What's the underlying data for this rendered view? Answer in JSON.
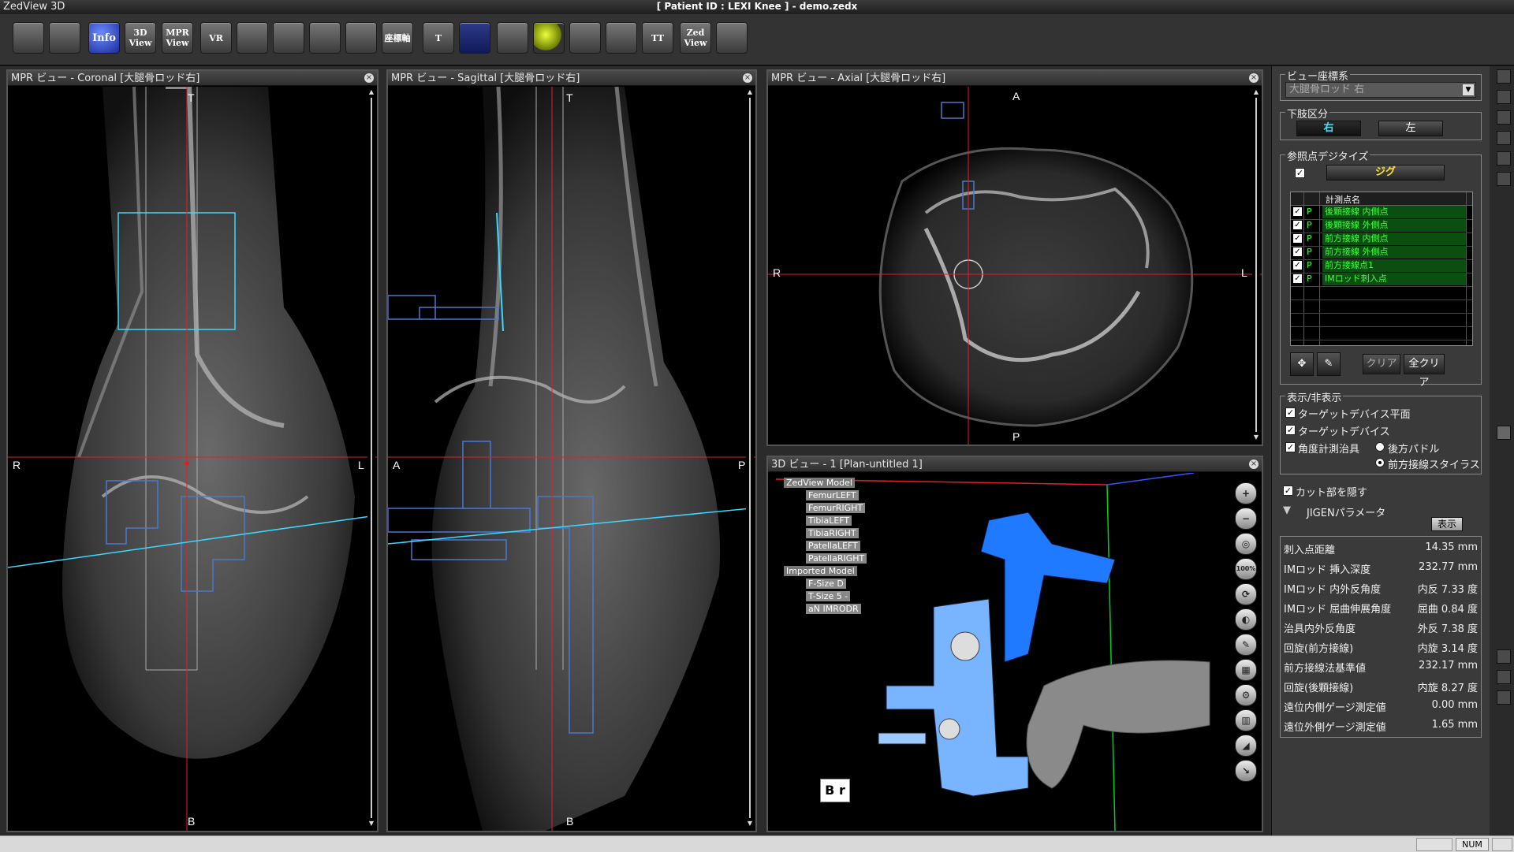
{
  "window": {
    "app_title": "ZedView 3D",
    "doc_title": "[ Patient ID : LEXI Knee ]  - demo.zedx"
  },
  "toolbar": {
    "buttons": [
      {
        "name": "tb-disk1-button",
        "label": ""
      },
      {
        "name": "tb-disk2-button",
        "label": ""
      },
      {
        "name": "tb-info-button",
        "label": "Info"
      },
      {
        "name": "tb-3dview-button",
        "label": "3D View"
      },
      {
        "name": "tb-mprview-button",
        "label": "MPR View"
      },
      {
        "name": "tb-vr-button",
        "label": "VR"
      },
      {
        "name": "tb-layout-button",
        "label": ""
      },
      {
        "name": "tb-slab-button",
        "label": ""
      },
      {
        "name": "tb-capture-button",
        "label": ""
      },
      {
        "name": "tb-zoom-button",
        "label": ""
      },
      {
        "name": "tb-coordaxis-button",
        "label": "座標軸"
      },
      {
        "name": "tb-text-button",
        "label": "T"
      },
      {
        "name": "tb-grid-button",
        "label": ""
      },
      {
        "name": "tb-cube-button",
        "label": ""
      },
      {
        "name": "tb-ball-button",
        "label": ""
      },
      {
        "name": "tb-eye-button",
        "label": ""
      },
      {
        "name": "tb-box-button",
        "label": ""
      },
      {
        "name": "tb-tt-button",
        "label": "TT"
      },
      {
        "name": "tb-zedview-button",
        "label": "Zed View"
      },
      {
        "name": "tb-dial-button",
        "label": ""
      }
    ]
  },
  "views": {
    "coronal": {
      "title": "MPR ビュー - Coronal [大腿骨ロッド右]",
      "top": "T",
      "bottom": "B",
      "left": "R",
      "right": "L"
    },
    "sagittal": {
      "title": "MPR ビュー - Sagittal [大腿骨ロッド右]",
      "top": "T",
      "bottom": "B",
      "left": "A",
      "right": "P"
    },
    "axial": {
      "title": "MPR ビュー - Axial [大腿骨ロッド右]",
      "top": "A",
      "bottom": "P",
      "left": "R",
      "right": "L"
    },
    "view3d": {
      "title": "3D ビュー - 1 [Plan-untitled 1]",
      "tree": {
        "group1": "ZedView Model",
        "items1": [
          "FemurLEFT",
          "FemurRIGHT",
          "TibiaLEFT",
          "TibiaRIGHT",
          "PatellaLEFT",
          "PatellaRIGHT"
        ],
        "group2": "Imported Model",
        "items2": [
          "F-Size D",
          "T-Size 5 -",
          "aN IMRODR"
        ]
      },
      "tools": [
        "+",
        "−",
        "◎",
        "100%",
        "⟳",
        "◐",
        "✎",
        "▦",
        "⚙",
        "▥",
        "◢",
        "↘"
      ],
      "cube_label": "B r"
    }
  },
  "panel": {
    "view_coord": {
      "label": "ビュー座標系",
      "value": "大腿骨ロッド 右"
    },
    "limb": {
      "label": "下肢区分",
      "right": "右",
      "left": "左"
    },
    "digitize": {
      "label": "参照点デジタイズ",
      "jig": "ジグ",
      "checked": "✓"
    },
    "table": {
      "header": "計測点名",
      "rows": [
        {
          "p": "P",
          "name": "後顆接線 内側点"
        },
        {
          "p": "P",
          "name": "後顆接線 外側点"
        },
        {
          "p": "P",
          "name": "前方接線 内側点"
        },
        {
          "p": "P",
          "name": "前方接線 外側点"
        },
        {
          "p": "P",
          "name": "前方接線点1"
        },
        {
          "p": "P",
          "name": "IMロッド刺入点"
        }
      ]
    },
    "buttons": {
      "clear": "クリア",
      "clear_all": "全クリア"
    },
    "display": {
      "label": "表示/非表示",
      "target_plane": "ターゲットデバイス平面",
      "target_device": "ターゲットデバイス",
      "angle_jig": "角度計測治具",
      "rear_paddle": "後方パドル",
      "front_stylus": "前方接線スタイラス"
    },
    "hide_cut": "カット部を隠す",
    "jigen": {
      "label": "JIGENパラメータ",
      "show": "表示"
    },
    "params": [
      {
        "k": "刺入点距離",
        "v": "14.35 mm"
      },
      {
        "k": "IMロッド 挿入深度",
        "v": "232.77 mm"
      },
      {
        "k": "IMロッド 内外反角度",
        "v": "内反 7.33 度"
      },
      {
        "k": "IMロッド 屈曲伸展角度",
        "v": "屈曲 0.84 度"
      },
      {
        "k": "治具内外反角度",
        "v": "外反 7.38 度"
      },
      {
        "k": "回旋(前方接線)",
        "v": "内旋 3.14 度"
      },
      {
        "k": "前方接線法基準値",
        "v": "232.17 mm"
      },
      {
        "k": "回旋(後顆接線)",
        "v": "内旋 8.27 度"
      },
      {
        "k": "遠位内側ゲージ測定値",
        "v": "0.00 mm"
      },
      {
        "k": "遠位外側ゲージ測定値",
        "v": "1.65 mm"
      }
    ]
  },
  "status": {
    "num": "NUM"
  },
  "colors": {
    "crosshair": "#e02020",
    "overlay": "#3bd8ff",
    "model": "#6fb5ff",
    "axis_green": "#00d020"
  }
}
